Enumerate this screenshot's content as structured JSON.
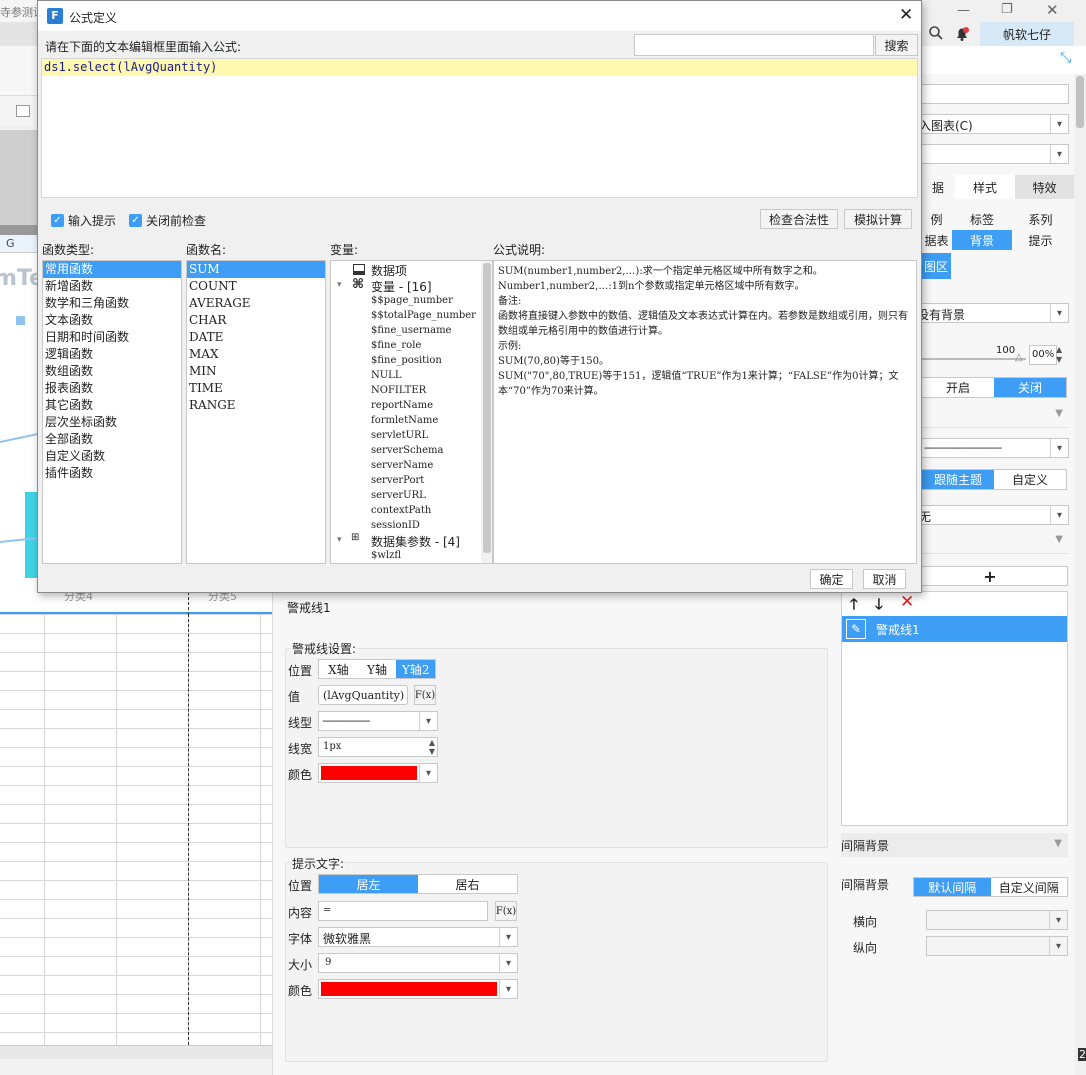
{
  "app": {
    "left_title_partial": "寺参测试",
    "user_name": "帆软七仔"
  },
  "dialog": {
    "title": "公式定义",
    "prompt": "请在下面的文本编辑框里面输入公式:",
    "search_button": "搜索",
    "search_value": "",
    "formula": "ds1.select(lAvgQuantity)",
    "input_hint_label": "输入提示",
    "check_before_close_label": "关闭前检查",
    "check_validity_button": "检查合法性",
    "simulate_button": "模拟计算",
    "headers": {
      "func_type": "函数类型:",
      "func_name": "函数名:",
      "variables": "变量:",
      "description": "公式说明:"
    },
    "func_types": [
      "常用函数",
      "新增函数",
      "数学和三角函数",
      "文本函数",
      "日期和时间函数",
      "逻辑函数",
      "数组函数",
      "报表函数",
      "其它函数",
      "层次坐标函数",
      "全部函数",
      "自定义函数",
      "插件函数"
    ],
    "func_names": [
      "SUM",
      "COUNT",
      "AVERAGE",
      "CHAR",
      "DATE",
      "MAX",
      "MIN",
      "TIME",
      "RANGE"
    ],
    "var_tree": {
      "data_items": "数据项",
      "variables_group": "变量 - [16]",
      "variables": [
        "$$page_number",
        "$$totalPage_number",
        "$fine_username",
        "$fine_role",
        "$fine_position",
        "NULL",
        "NOFILTER",
        "reportName",
        "formletName",
        "servletURL",
        "serverSchema",
        "serverName",
        "serverPort",
        "serverURL",
        "contextPath",
        "sessionID"
      ],
      "dataset_params_group": "数据集参数 - [4]",
      "dataset_params": [
        "$wlzfl"
      ]
    },
    "description_lines": [
      "SUM(number1,number2,…):求一个指定单元格区域中所有数字之和。",
      "Number1,number2,…:1到n个参数或指定单元格区域中所有数字。",
      "备注:",
      "函数将直接键入参数中的数值、逻辑值及文本表达式计算在内。若参数是数组或引用，则只有数组或单元格引用中的数值进行计算。",
      "示例:",
      "SUM(70,80)等于150。",
      "SUM(\"70\",80,TRUE)等于151，逻辑值“TRUE”作为1来计算；“FALSE”作为0计算；文本“70”作为70来计算。"
    ],
    "ok_button": "确定",
    "cancel_button": "取消"
  },
  "left_canvas": {
    "category_labels": [
      "分类4",
      "分类5"
    ],
    "fragment_text": "mTex",
    "col_label": "G"
  },
  "middle": {
    "panel_title": "警戒线1",
    "line_settings_title": "警戒线设置:",
    "position_label": "位置",
    "position_options": [
      "X轴",
      "Y轴",
      "Y轴2"
    ],
    "position_selected": "Y轴2",
    "value_label": "值",
    "value": "(lAvgQuantity)",
    "fx_label": "F(x)",
    "line_type_label": "线型",
    "line_type_value": "----------------",
    "line_width_label": "线宽",
    "line_width_value": "1px",
    "color_label": "颜色",
    "line_color": "#ff0000",
    "hint_title": "提示文字:",
    "hint_position_label": "位置",
    "hint_position_options": [
      "居左",
      "居右"
    ],
    "hint_position_selected": "居左",
    "content_label": "内容",
    "content_value": "=",
    "font_label": "字体",
    "font_value": "微软雅黑",
    "size_label": "大小",
    "size_value": "9",
    "hint_color_label": "颜色",
    "hint_color": "#ff0000"
  },
  "right": {
    "chart_type_partial": "入图表(C)",
    "tabs_row1": [
      "据",
      "样式",
      "特效"
    ],
    "tabs_row2": [
      "例",
      "标签",
      "系列"
    ],
    "tabs_row3": [
      "据表",
      "背景",
      "提示"
    ],
    "tab_area": "图区",
    "background_select": "没有背景",
    "slider_max": "100",
    "percent_value": "00%",
    "toggle_options": [
      "开启",
      "关闭"
    ],
    "toggle_selected": "关闭",
    "line_dash": "--------------------------",
    "theme_options": [
      "跟随主题",
      "自定义"
    ],
    "theme_selected": "跟随主题",
    "none_select": "无",
    "add_symbol": "+",
    "list_item": "警戒线1",
    "interval_bg_section": "间隔背景",
    "interval_bg_label": "间隔背景",
    "interval_options": [
      "默认间隔",
      "自定义间隔"
    ],
    "interval_selected": "默认间隔",
    "horizontal_label": "横向",
    "vertical_label": "纵向",
    "corner_digit": "2"
  }
}
